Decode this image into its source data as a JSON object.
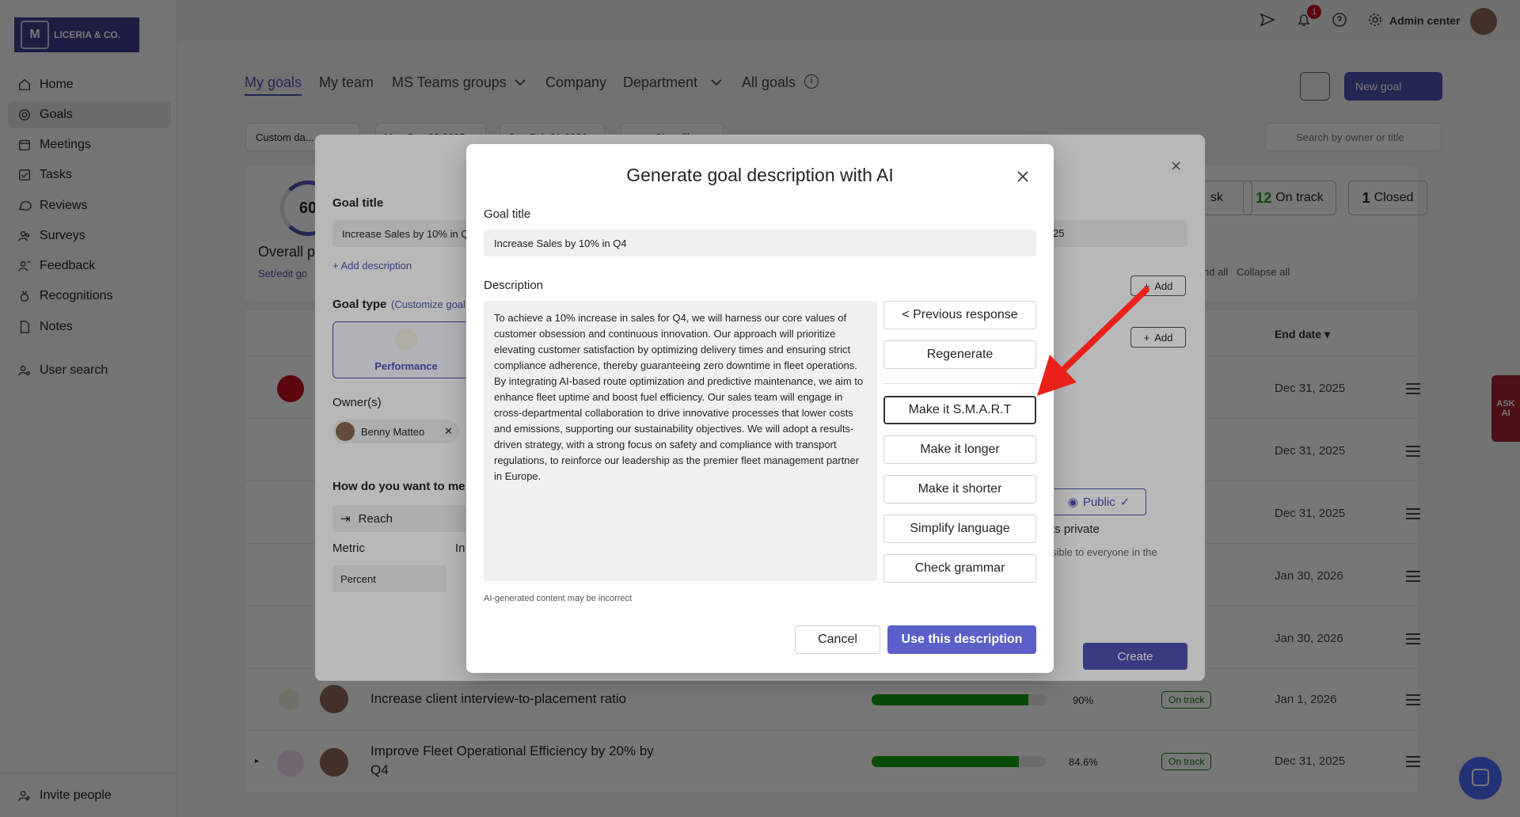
{
  "app": {
    "logo_text": "LICERIA & CO.",
    "logo_mark": "M",
    "admin_center": "Admin center",
    "notification_count": "1"
  },
  "sidebar": {
    "items": [
      {
        "label": "Home",
        "icon": "home-icon"
      },
      {
        "label": "Goals",
        "icon": "goals-icon",
        "active": true
      },
      {
        "label": "Meetings",
        "icon": "calendar-icon"
      },
      {
        "label": "Tasks",
        "icon": "checkbox-icon"
      },
      {
        "label": "Reviews",
        "icon": "chat-icon"
      },
      {
        "label": "Surveys",
        "icon": "people-icon"
      },
      {
        "label": "Feedback",
        "icon": "feedback-icon"
      },
      {
        "label": "Recognitions",
        "icon": "trophy-icon"
      },
      {
        "label": "Notes",
        "icon": "note-icon"
      }
    ],
    "user_search": "User search",
    "invite_people": "Invite people"
  },
  "tabs": [
    {
      "label": "My goals",
      "active": true
    },
    {
      "label": "My team"
    },
    {
      "label": "MS Teams groups"
    },
    {
      "label": "Company"
    },
    {
      "label": "Department"
    },
    {
      "label": "All goals"
    }
  ],
  "toolbar": {
    "new_goal": "New goal",
    "search_placeholder": "Search by owner or title",
    "custom_date": "Custom da...",
    "date_from": "Mon Sep 22 2025",
    "date_to": "Sun Feb 01 2026",
    "clear_filters": "Clear filters"
  },
  "summary": {
    "overall_percent": "60",
    "overall_label": "Overall p",
    "set_edit": "Set/edit go",
    "at_risk_suffix": "sk",
    "on_track_count": "12",
    "on_track_label": "On track",
    "closed_count": "1",
    "closed_label": "Closed",
    "expand_all": "nd all",
    "collapse_all": "Collapse all",
    "end_date_header": "End date"
  },
  "rows": [
    {
      "title": "",
      "end_date": "Dec 31, 2025"
    },
    {
      "title": "",
      "end_date": "Dec 31, 2025"
    },
    {
      "title": "",
      "end_date": "Dec 31, 2025"
    },
    {
      "title": "",
      "end_date": "Jan 30, 2026"
    },
    {
      "title": "",
      "end_date": "Jan 30, 2026"
    },
    {
      "title": "Increase client interview-to-placement ratio",
      "progress": "90%",
      "progress_value": 0.9,
      "status": "On track",
      "end_date": "Jan 1, 2026"
    },
    {
      "title": "Improve Fleet Operational Efficiency by 20% by",
      "title2": "Q4",
      "progress": "84.6%",
      "progress_value": 0.846,
      "status": "On track",
      "end_date": "Dec 31, 2025"
    }
  ],
  "goal_dialog": {
    "goal_title_label": "Goal title",
    "goal_title_value": "Increase Sales by 10% in Q",
    "goal_title_right": "25",
    "add_description": "+ Add description",
    "goal_type_label": "Goal type",
    "customize_goal": "(Customize goal",
    "performance": "Performance",
    "owners_label": "Owner(s)",
    "owner_name": "Benny Matteo",
    "measure_label": "How do you want to me",
    "reach": "Reach",
    "metric_label": "Metric",
    "in_label": "In",
    "metric_value": "Percent",
    "add": "Add",
    "add2": "Add",
    "public": "Public",
    "private_text": "ts private",
    "visible_text": "sible to everyone in the",
    "create": "Create"
  },
  "ai_dialog": {
    "title": "Generate goal description with AI",
    "goal_title_label": "Goal title",
    "goal_title_value": "Increase Sales by 10% in Q4",
    "description_label": "Description",
    "description_text": "To achieve a 10% increase in sales for Q4, we will harness our core values of customer obsession and continuous innovation. Our approach will prioritize elevating customer satisfaction by optimizing delivery times and ensuring strict compliance adherence, thereby guaranteeing zero downtime in fleet operations. By integrating AI-based route optimization and predictive maintenance, we aim to enhance fleet uptime and boost fuel efficiency. Our sales team will engage in cross-departmental collaboration to drive innovative processes that lower costs and emissions, supporting our sustainability objectives. We will adopt a results-driven strategy, with a strong focus on safety and compliance with transport regulations, to reinforce our leadership as the premier fleet management partner in Europe.",
    "previous_response": "< Previous response",
    "regenerate": "Regenerate",
    "make_smart": "Make it S.M.A.R.T",
    "make_longer": "Make it longer",
    "make_shorter": "Make it shorter",
    "simplify": "Simplify language",
    "check_grammar": "Check grammar",
    "disclaimer": "AI-generated content may be incorrect",
    "cancel": "Cancel",
    "use_description": "Use this description"
  },
  "ask_ai": "ASK AI",
  "colors": {
    "brand": "#4f52b2",
    "arrow": "#e8221b",
    "on_track": "#13a10e"
  }
}
